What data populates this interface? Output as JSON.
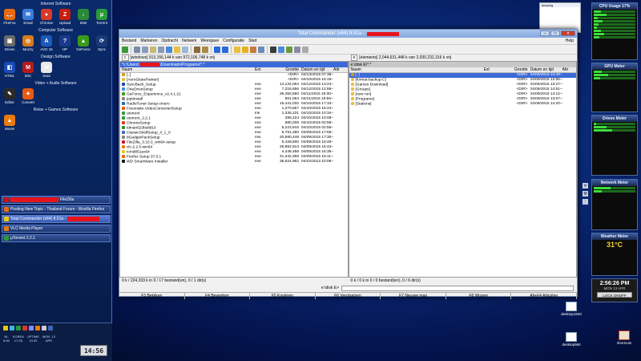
{
  "sidebar": {
    "internet_title": "Internet Software",
    "internet_icons": [
      {
        "label": "FireFox",
        "color": "#e86a10",
        "glyph": "🦊"
      },
      {
        "label": "Email",
        "color": "#3a7ad8",
        "glyph": "✉"
      },
      {
        "label": "Chrome",
        "color": "#d83a2a",
        "glyph": "●"
      },
      {
        "label": "Upload",
        "color": "#c82010",
        "glyph": "Z"
      },
      {
        "label": "IDM",
        "color": "#2a8a3a",
        "glyph": "↓"
      },
      {
        "label": "Torrent",
        "color": "#2a9a3a",
        "glyph": "μ"
      }
    ],
    "computer_title": "Computer Software",
    "computer_icons": [
      {
        "label": "Drives",
        "color": "#6a6a6a",
        "glyph": "▣"
      },
      {
        "label": "Mozzy",
        "color": "#d87a1a",
        "glyph": "◎"
      },
      {
        "label": "AVG 15",
        "color": "#1a5ab8",
        "glyph": "A"
      },
      {
        "label": "HP",
        "color": "#1a3a8a",
        "glyph": "?"
      },
      {
        "label": "GeForce",
        "color": "#3a9a1a",
        "glyph": "▲"
      },
      {
        "label": "Sync",
        "color": "#1a3a7a",
        "glyph": "⟳"
      }
    ],
    "design_title": "Design Software",
    "design_icons": [
      {
        "label": "HTML",
        "color": "#1a4ab8",
        "glyph": "◧"
      },
      {
        "label": "MIC",
        "color": "#b81a1a",
        "glyph": "M"
      },
      {
        "label": "Xara",
        "color": "#e8e8e8",
        "glyph": "W"
      }
    ],
    "video_title": "Video + Audio Software",
    "video_icons": [
      {
        "label": "Editor",
        "color": "#2a2a2a",
        "glyph": "✎"
      },
      {
        "label": "Convert",
        "color": "#e85a10",
        "glyph": "✦"
      }
    ],
    "relax_title": "Relax + Games Software",
    "relax_icons": [
      {
        "label": "Movie",
        "color": "#e87a10",
        "glyph": "▲"
      }
    ]
  },
  "tasks": [
    {
      "label": "FileZilla",
      "color": "#c8141c",
      "redacted": true
    },
    {
      "label": "Posting New Topic - Thailand Forum - Mozilla Firefox",
      "color": "#e86a10",
      "redacted": false
    },
    {
      "label": "Total Commander (x64) 8.51a -",
      "color": "#e8c810",
      "redacted": true,
      "active": true
    },
    {
      "label": "VLC Media Player",
      "color": "#e87a10",
      "redacted": false
    },
    {
      "label": "µTorrent 2.2.1",
      "color": "#2a9a3a",
      "redacted": false
    }
  ],
  "tray": {
    "clocks": [
      {
        "city": "NL",
        "time": "8:56"
      },
      {
        "city": "KOREA",
        "time": "17:26"
      },
      {
        "city": "UPTIME",
        "time": "10:30"
      },
      {
        "city": "MON. 13",
        "time": "APR"
      }
    ],
    "time": "14:56"
  },
  "tc": {
    "title": "Total Commander (x64) 8.51a -",
    "menu": [
      "Bestand",
      "Markeren",
      "Opdracht",
      "Netwerk",
      "Weergave",
      "Configuratie",
      "Start"
    ],
    "help": "Help",
    "left": {
      "drive": "c",
      "info": "[windows]  913,156,144 k van 972,106,748 k vrij",
      "path_prefix": "*c:\\Users\\",
      "path_suffix": "\\Downloads\\Programs\\*.*",
      "status": "0 k / 224,333 k in 0 / 17 bestand(en), 0 / 1 dir(s)"
    },
    "right": {
      "drive": "e",
      "info": "[elements]  2,044,631,448 k van 2,930,232,316 k vrij",
      "path": "e:\\disk E\\*.*",
      "status": "0 k / 0 k in 0 / 0 bestand(en), 0 / 6 dir(s)"
    },
    "columns": {
      "name": "Naam",
      "ext": "Ext",
      "size": "Grootte",
      "date": "Datum en tijd",
      "attr": "Attr"
    },
    "left_files": [
      {
        "name": "[..]",
        "ext": "",
        "size": "<DIR>",
        "date": "04/13/2015 07:38—",
        "color": "#c8a020",
        "sel": false
      },
      {
        "name": "[AeroGlassPainter]",
        "ext": "",
        "size": "<DIR>",
        "date": "04/10/2015 15:18—",
        "color": "#e8c040",
        "sel": false
      },
      {
        "name": "SyncBack_Setup",
        "ext": "exe",
        "size": "14,134,064",
        "date": "04/12/2015 13:24—",
        "color": "#1a4aa8",
        "sel": false
      },
      {
        "name": "OneDriveSetup",
        "ext": "exe",
        "size": "7,218,656",
        "date": "04/12/2015 12:59—",
        "color": "#3a8ae8",
        "sel": false
      },
      {
        "name": "GeForce_Experience_v2.4.1.21",
        "ext": "exe",
        "size": "36,450,560",
        "date": "04/11/2015 16:30—",
        "color": "#3a9a1a",
        "sel": false
      },
      {
        "name": "jeptinstall",
        "ext": "exe",
        "size": "561,064",
        "date": "04/11/2015 15:55—",
        "color": "#888888",
        "sel": false
      },
      {
        "name": "RadioTuner-Setup-cinero",
        "ext": "exe",
        "size": "16,441,032",
        "date": "04/10/2015 17:33—",
        "color": "#1a6ab8",
        "sel": false
      },
      {
        "name": "Freemake.VideoConverterSetup",
        "ext": "exe",
        "size": "1,270,557",
        "date": "04/10/2015 16:24—",
        "color": "#e85a10",
        "sel": false
      },
      {
        "name": "utorrent",
        "ext": "lnk",
        "size": "1,335,231",
        "date": "04/10/2015 10:34—",
        "color": "#2a9a3a",
        "sel": false
      },
      {
        "name": "utorrent_2.2.1",
        "ext": "exe",
        "size": "399,224",
        "date": "04/10/2015 10:08—",
        "color": "#2a9a3a",
        "sel": false
      },
      {
        "name": "ChromeSetup",
        "ext": "exe",
        "size": "880,208",
        "date": "04/10/2015 02:58—",
        "color": "#d83a2a",
        "sel": false
      },
      {
        "name": "idman623build10",
        "ext": "exe",
        "size": "6,223,816",
        "date": "04/10/2015 02:55—",
        "color": "#2a8a3a",
        "sel": false
      },
      {
        "name": "ClassicShellSetup_4_1_0",
        "ext": "exe",
        "size": "6,791,360",
        "date": "04/09/2015 17:55—",
        "color": "#3a6ab8",
        "sel": false
      },
      {
        "name": "8GadgetPackSetup",
        "ext": "msi",
        "size": "20,580,448",
        "date": "04/09/2015 17:30—",
        "color": "#888888",
        "sel": false
      },
      {
        "name": "FileZilla_3.10.3_win64-setup",
        "ext": "exe",
        "size": "6,428,600",
        "date": "04/09/2015 16:48—",
        "color": "#c8141c",
        "sel": false
      },
      {
        "name": "vlc-2.2.0-win64",
        "ext": "exe",
        "size": "29,882,913",
        "date": "04/09/2015 16:43—",
        "color": "#e87a10",
        "sel": false
      },
      {
        "name": "tcmd851ax64",
        "ext": "exe",
        "size": "4,448,488",
        "date": "04/09/2015 16:35—",
        "color": "#e8c810",
        "sel": false
      },
      {
        "name": "Firefox Setup 37.0.1",
        "ext": "exe",
        "size": "41,342,368",
        "date": "04/09/2015 16:11—",
        "color": "#e86a10",
        "sel": false
      },
      {
        "name": "WD SmartWare Installer",
        "ext": "exe",
        "size": "35,624,952",
        "date": "04/22/2013 10:08—",
        "color": "#1a1a1a",
        "sel": false
      }
    ],
    "right_files": [
      {
        "name": "[..]",
        "ext": "",
        "size": "<DIR>",
        "date": "04/09/2015 13:48—",
        "color": "#c8a020",
        "sel": true
      },
      {
        "name": "[format-backup-C]",
        "ext": "",
        "size": "<DIR>",
        "date": "04/09/2015 12:56—",
        "color": "#e8c040",
        "sel": false
      },
      {
        "name": "[Games Download]",
        "ext": "",
        "size": "<DIR>",
        "date": "04/09/2015 13:27—",
        "color": "#e8c040",
        "sel": false
      },
      {
        "name": "[Groups]",
        "ext": "",
        "size": "<DIR>",
        "date": "04/09/2015 14:51—",
        "color": "#e8c040",
        "sel": false
      },
      {
        "name": "[new ron]",
        "ext": "",
        "size": "<DIR>",
        "date": "04/09/2015 14:12—",
        "color": "#e8c040",
        "sel": false
      },
      {
        "name": "[Programs]",
        "ext": "",
        "size": "<DIR>",
        "date": "04/09/2015 13:57—",
        "color": "#e8c040",
        "sel": false
      },
      {
        "name": "[Stations]",
        "ext": "",
        "size": "<DIR>",
        "date": "04/09/2015 14:20—",
        "color": "#e8c040",
        "sel": false
      }
    ],
    "cmd_prompt": "e:\\disk E>",
    "fkeys": [
      "F3 Bekijken",
      "F4 Bewerken",
      "F5 Kopiëren",
      "F6 Verplaatsen",
      "F7 Nieuwe map",
      "F8 Wissen",
      "Alt+F4 Afsluiten"
    ]
  },
  "gadgets": {
    "cpu_title": "CPU Usage 17%",
    "cpu_value": 17,
    "gpu_title": "GPU Meter",
    "drives_title": "Drives Meter",
    "network_title": "Network Meter",
    "weather_title": "Weather Meter",
    "weather_temp": "31°C",
    "clock_time": "2:56:26 PM",
    "clock_date": "MON 13 APR",
    "lock_label": "LOCK ONOFF"
  },
  "desktop": {
    "icons": [
      {
        "label": "desktop1920"
      },
      {
        "label": "desktop960"
      },
      {
        "label": "shortcuts"
      }
    ],
    "thumb_label": "beeping"
  }
}
